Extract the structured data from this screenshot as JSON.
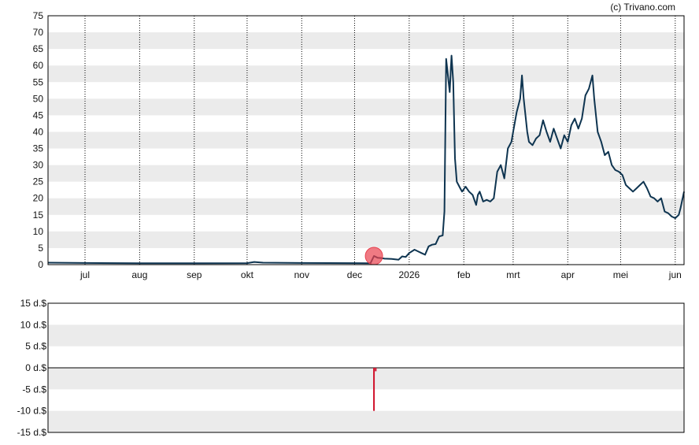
{
  "credit": "(c) Trivano.com",
  "colors": {
    "price_line": "#0e3450",
    "band": "#ebebeb",
    "event_marker": "#e8414f",
    "bar": "#d0112b"
  },
  "chart_data": [
    {
      "type": "line",
      "title": "",
      "xlabel": "",
      "ylabel": "",
      "ylim": [
        0,
        75
      ],
      "y_ticks": [
        "0",
        "5",
        "10",
        "15",
        "20",
        "25",
        "30",
        "35",
        "40",
        "45",
        "50",
        "55",
        "60",
        "65",
        "70",
        "75"
      ],
      "x_ticks": [
        "jul",
        "aug",
        "sep",
        "okt",
        "nov",
        "dec",
        "2026",
        "feb",
        "mrt",
        "apr",
        "mei",
        "jun"
      ],
      "x_range": [
        "2025-06-10",
        "2026-06-06"
      ],
      "x_tick_dates": [
        "2025-07-01",
        "2025-08-01",
        "2025-09-01",
        "2025-10-01",
        "2025-11-01",
        "2025-12-01",
        "2026-01-01",
        "2026-02-01",
        "2026-03-01",
        "2026-04-01",
        "2026-05-01",
        "2026-06-01"
      ],
      "grid": "vertical dotted lines at month starts, alternating horizontal bands",
      "series": [
        {
          "x": [
            "2025-06-10",
            "2025-07-01",
            "2025-08-01",
            "2025-09-01",
            "2025-10-01",
            "2025-10-05",
            "2025-10-10",
            "2025-11-01",
            "2025-12-01",
            "2025-12-10",
            "2025-12-12",
            "2025-12-14",
            "2025-12-16",
            "2025-12-18",
            "2025-12-22",
            "2025-12-26",
            "2025-12-28",
            "2025-12-30",
            "2026-01-01",
            "2026-01-04",
            "2026-01-06",
            "2026-01-08",
            "2026-01-10",
            "2026-01-12",
            "2026-01-14",
            "2026-01-16",
            "2026-01-18",
            "2026-01-20",
            "2026-01-21",
            "2026-01-22",
            "2026-01-24",
            "2026-01-25",
            "2026-01-26",
            "2026-01-27",
            "2026-01-28",
            "2026-01-29",
            "2026-01-30",
            "2026-01-31",
            "2026-02-02",
            "2026-02-04",
            "2026-02-06",
            "2026-02-08",
            "2026-02-09",
            "2026-02-10",
            "2026-02-12",
            "2026-02-14",
            "2026-02-16",
            "2026-02-18",
            "2026-02-20",
            "2026-02-22",
            "2026-02-24",
            "2026-02-26",
            "2026-02-28",
            "2026-03-01",
            "2026-03-03",
            "2026-03-05",
            "2026-03-06",
            "2026-03-07",
            "2026-03-09",
            "2026-03-10",
            "2026-03-12",
            "2026-03-14",
            "2026-03-16",
            "2026-03-18",
            "2026-03-20",
            "2026-03-22",
            "2026-03-24",
            "2026-03-26",
            "2026-03-28",
            "2026-03-30",
            "2026-04-01",
            "2026-04-03",
            "2026-04-05",
            "2026-04-07",
            "2026-04-09",
            "2026-04-11",
            "2026-04-13",
            "2026-04-15",
            "2026-04-16",
            "2026-04-18",
            "2026-04-20",
            "2026-04-22",
            "2026-04-24",
            "2026-04-26",
            "2026-04-28",
            "2026-04-30",
            "2026-05-02",
            "2026-05-04",
            "2026-05-06",
            "2026-05-08",
            "2026-05-10",
            "2026-05-12",
            "2026-05-14",
            "2026-05-16",
            "2026-05-18",
            "2026-05-20",
            "2026-05-22",
            "2026-05-24",
            "2026-05-26",
            "2026-05-28",
            "2026-05-30",
            "2026-06-01",
            "2026-06-03",
            "2026-06-04",
            "2026-06-06"
          ],
          "values": [
            0.6,
            0.5,
            0.4,
            0.4,
            0.45,
            0.8,
            0.6,
            0.5,
            0.45,
            0.4,
            2.6,
            2.1,
            2.0,
            1.8,
            1.7,
            1.5,
            2.5,
            2.3,
            3.5,
            4.5,
            4.0,
            3.5,
            3.0,
            5.5,
            6.0,
            6.2,
            8.5,
            8.8,
            16.0,
            62.0,
            52.0,
            63.0,
            55.0,
            32.0,
            25.0,
            24.0,
            23.0,
            22.0,
            23.5,
            22.0,
            21.0,
            18.0,
            21.0,
            22.0,
            19.0,
            19.5,
            19.0,
            20.0,
            28.0,
            30.0,
            26.0,
            35.0,
            37.0,
            40.0,
            46.0,
            50.0,
            57.0,
            50.0,
            40.0,
            37.0,
            36.0,
            38.0,
            39.0,
            43.5,
            40.0,
            37.0,
            41.0,
            38.0,
            35.0,
            39.0,
            37.0,
            42.0,
            44.0,
            41.0,
            44.0,
            51.0,
            53.0,
            57.0,
            50.0,
            40.0,
            37.0,
            33.0,
            34.0,
            30.0,
            28.5,
            28.0,
            27.0,
            24.0,
            23.0,
            22.0,
            23.0,
            24.0,
            25.0,
            23.0,
            20.5,
            20.0,
            19.0,
            20.0,
            16.0,
            15.5,
            14.5,
            14.0,
            15.0,
            17.0,
            22.0
          ]
        }
      ],
      "annotations": [
        {
          "type": "marker",
          "x": "2025-12-12",
          "y": 2.6
        }
      ]
    },
    {
      "type": "bar",
      "title": "",
      "xlabel": "",
      "ylabel": "",
      "ylim": [
        -15,
        15
      ],
      "y_ticks": [
        "15 d.$",
        "10 d.$",
        "5 d.$",
        "0 d.$",
        "-5 d.$",
        "-10 d.$",
        "-15 d.$"
      ],
      "grid": "alternating horizontal bands, zero line",
      "series": [
        {
          "x": [
            "2025-12-12",
            "2025-12-13"
          ],
          "values": [
            -10.0,
            -0.8
          ]
        }
      ]
    }
  ]
}
